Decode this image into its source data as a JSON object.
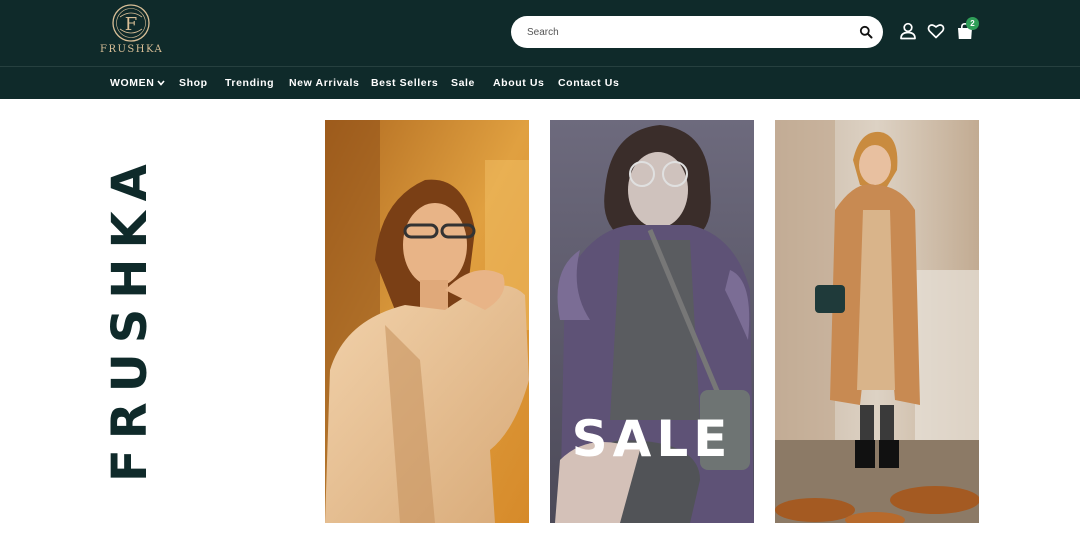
{
  "brand": {
    "logo_text": "FRUSHKA",
    "logo_monogram": "F",
    "vertical_title": "FRUSHKA",
    "logo_icon": "brand-monogram-logo"
  },
  "header": {
    "search": {
      "placeholder": "Search",
      "value": ""
    },
    "icons": [
      "search-icon",
      "user-icon",
      "heart-icon",
      "shopping-bag-icon"
    ],
    "cart_count": "2"
  },
  "nav": {
    "items": [
      {
        "label": "WOMEN",
        "has_dropdown": true
      },
      {
        "label": "Shop"
      },
      {
        "label": "Trending"
      },
      {
        "label": "New Arrivals"
      },
      {
        "label": "Best Sellers"
      },
      {
        "label": "Sale"
      },
      {
        "label": "About Us"
      },
      {
        "label": "Contact Us"
      }
    ]
  },
  "hero": {
    "panels": [
      {
        "name": "woman-in-beige-coat-photo"
      },
      {
        "name": "woman-in-fur-jacket-photo",
        "overlay_text": "SALE"
      },
      {
        "name": "woman-in-camel-coat-photo"
      }
    ]
  },
  "colors": {
    "header_bg": "#0f2a2a",
    "brand_text": "#0f2a2a",
    "logo_gold": "#d9bf97",
    "badge": "#2f9e58"
  }
}
